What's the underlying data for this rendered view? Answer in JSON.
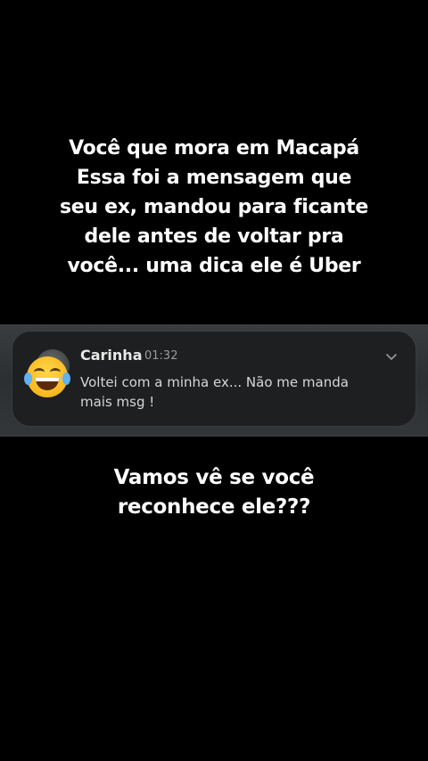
{
  "caption_top": {
    "lines": [
      "Você que mora em Macapá",
      "Essa foi a mensagem que",
      "seu ex, mandou para ficante",
      "dele antes de voltar pra",
      "você... uma dica ele é Uber"
    ]
  },
  "notification": {
    "sender": "Carinha",
    "time": "01:32",
    "message": "Voltei com a minha ex... Não me manda mais msg !",
    "avatar_icon": "face-with-tears-of-joy-emoji"
  },
  "caption_bottom": {
    "lines": [
      "Vamos vê se você",
      "reconhece ele???"
    ]
  },
  "colors": {
    "background": "#000000",
    "card": "#1d1f21",
    "text": "#ffffff"
  }
}
